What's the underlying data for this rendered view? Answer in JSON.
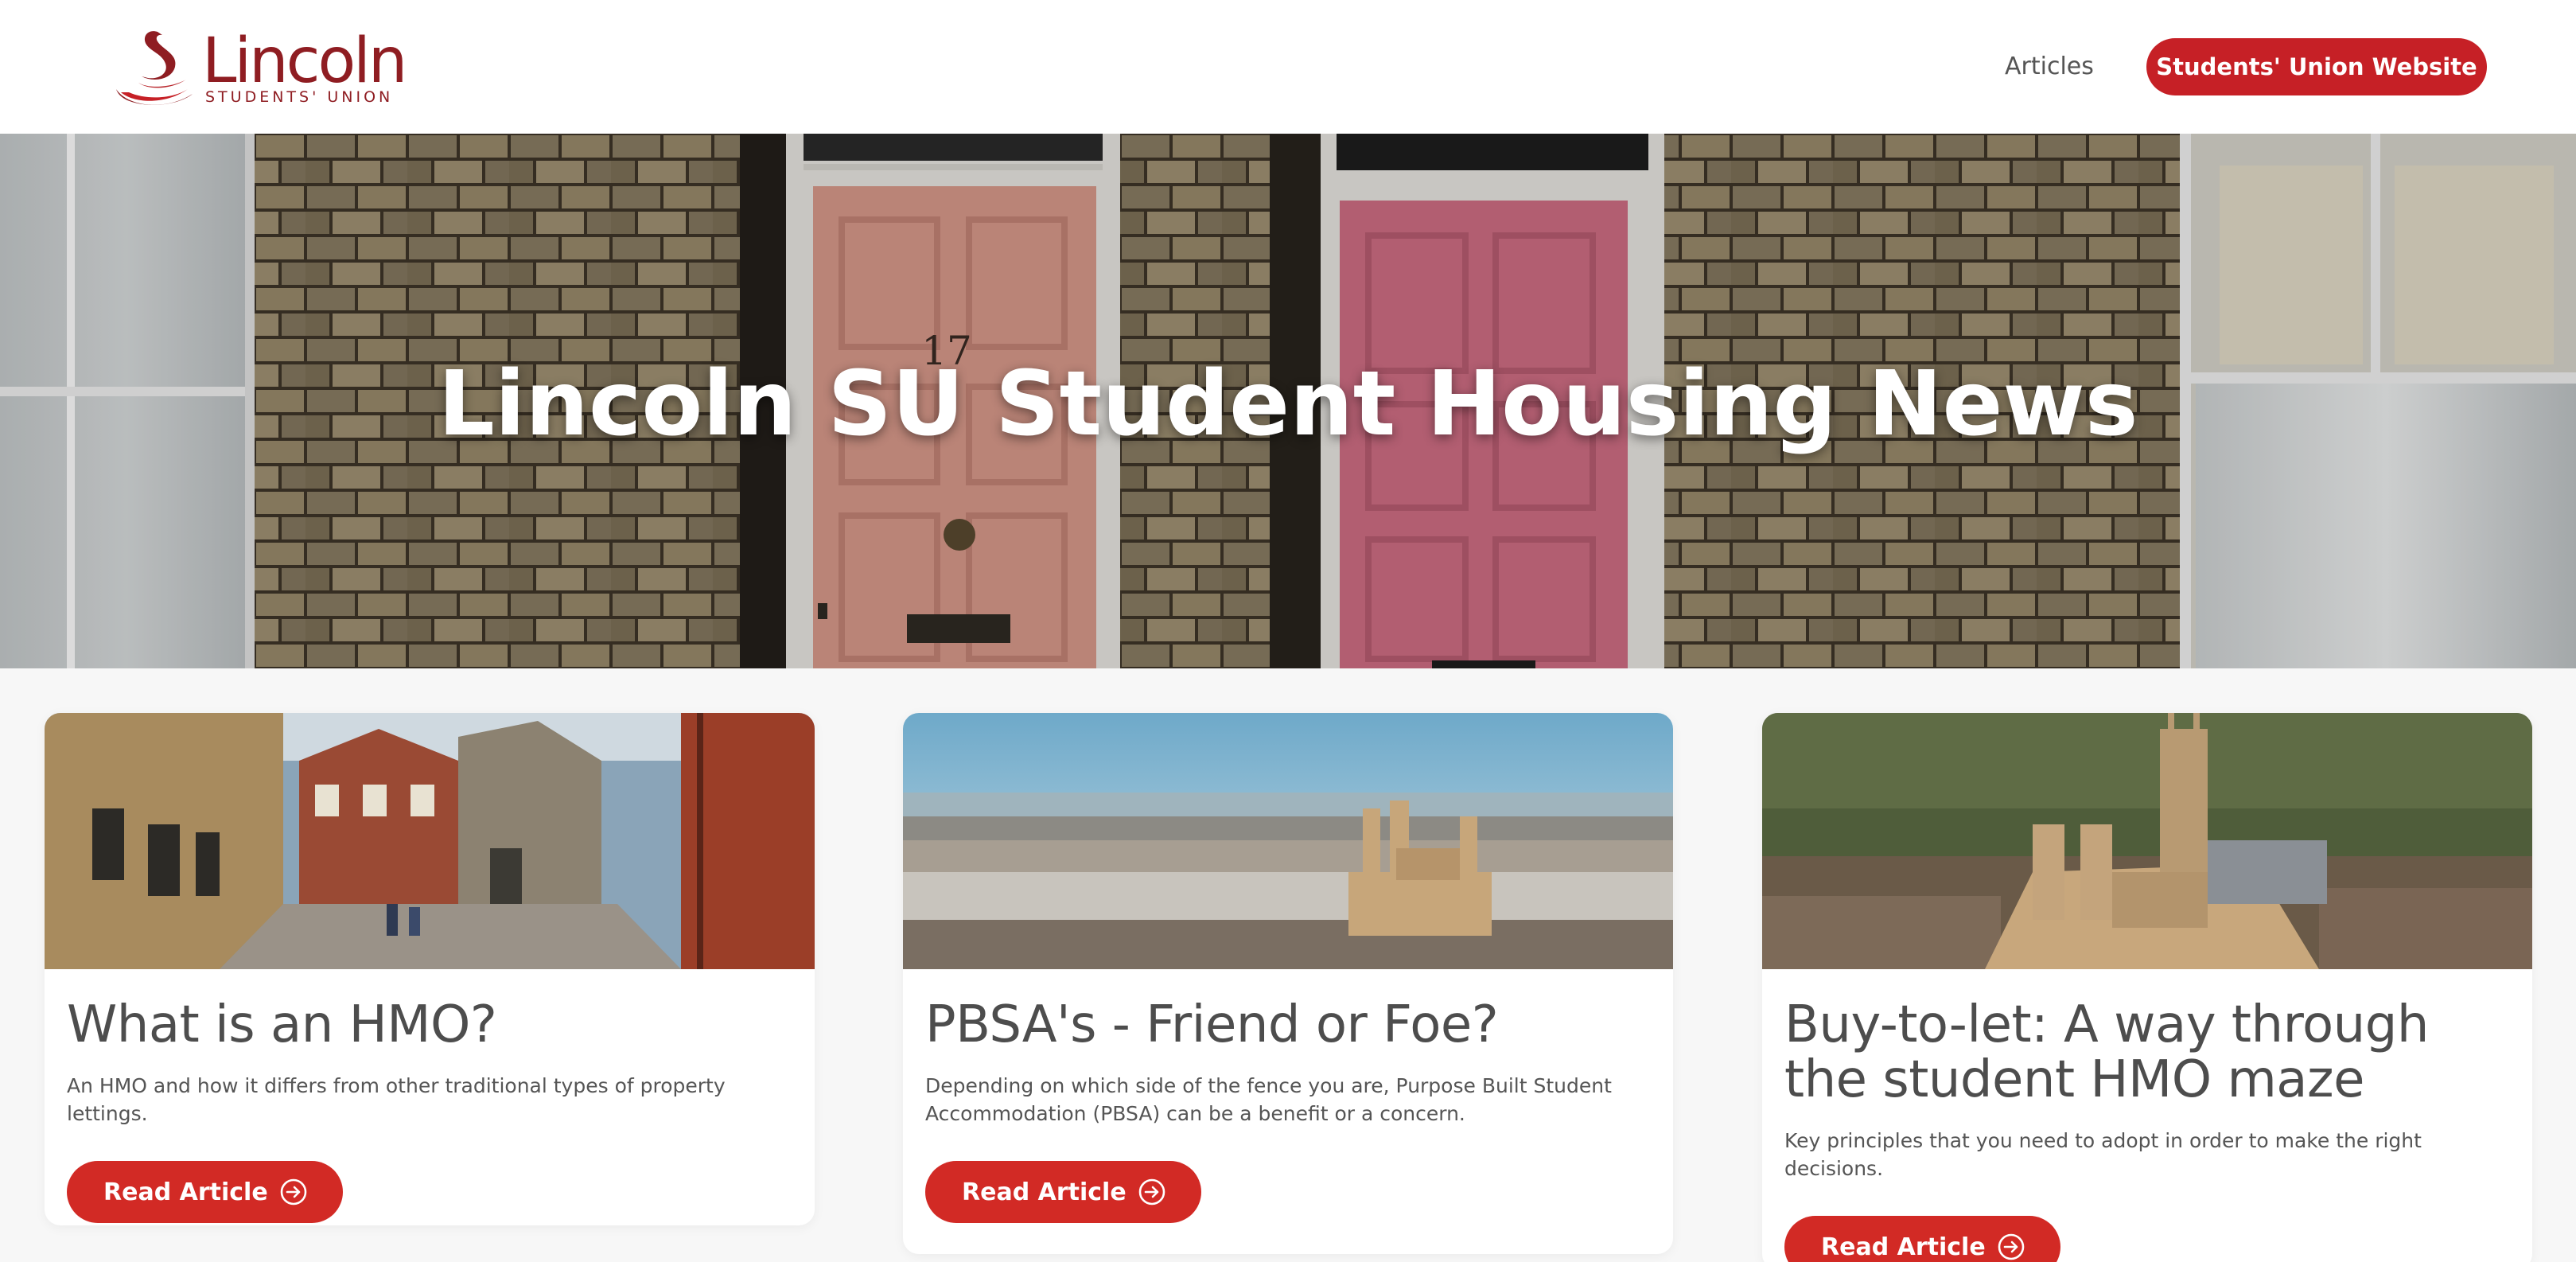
{
  "header": {
    "logo_word": "Lincoln",
    "logo_sub": "STUDENTS' UNION",
    "nav_articles": "Articles",
    "su_button": "Students' Union Website"
  },
  "hero": {
    "title": "Lincoln SU Student Housing News",
    "door_number": "17"
  },
  "cards": [
    {
      "title": "What is an HMO?",
      "description": "An HMO and how it differs from other traditional types of property lettings.",
      "button": "Read Article"
    },
    {
      "title": "PBSA's - Friend or Foe?",
      "description": "Depending on which side of the fence you are, Purpose Built Student Accommodation (PBSA) can be a benefit or a concern.",
      "button": "Read Article"
    },
    {
      "title": "Buy-to-let: A way through the student HMO maze",
      "description": "Key principles that you need to adopt in order to make the right decisions.",
      "button": "Read Article"
    }
  ],
  "colors": {
    "brand_maroon": "#8f1d22",
    "button_red": "#d22a25",
    "page_background": "#f7f7f7"
  },
  "icons": {
    "logo": "swan-logo-icon",
    "read_article": "arrow-right-circle-icon"
  }
}
